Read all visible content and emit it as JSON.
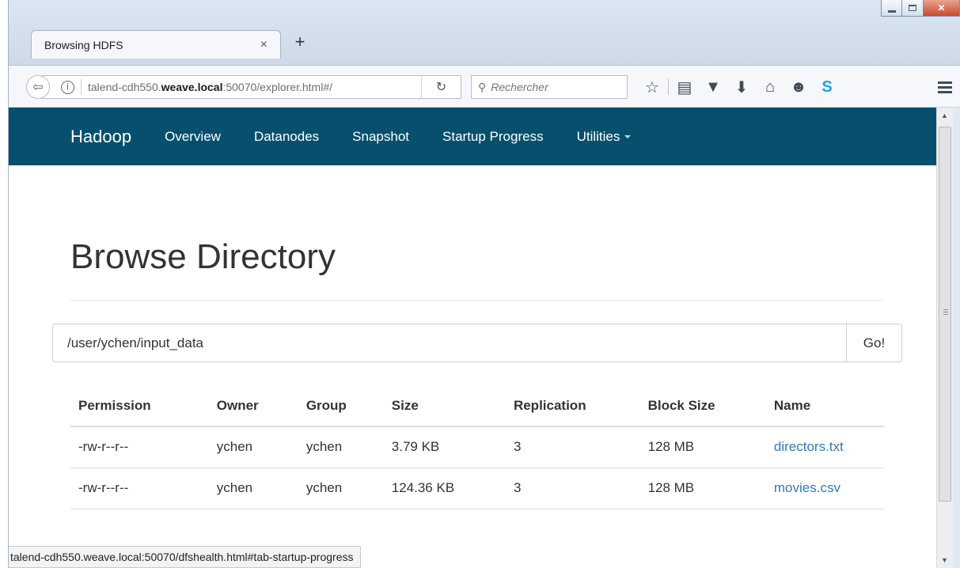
{
  "browser": {
    "tab_title": "Browsing HDFS",
    "tab_close": "×",
    "new_tab": "+",
    "url_prefix": "talend-cdh550.",
    "url_domain": "weave.local",
    "url_suffix": ":50070/explorer.html#/",
    "search_placeholder": "Rechercher",
    "status_url": "talend-cdh550.weave.local:50070/dfshealth.html#tab-startup-progress",
    "toolbar_icons": [
      "bookmark-star-icon",
      "reading-list-icon",
      "pocket-icon",
      "download-icon",
      "home-icon",
      "emoji-icon",
      "skype-icon",
      "menu-icon"
    ]
  },
  "nav": {
    "brand": "Hadoop",
    "items": [
      "Overview",
      "Datanodes",
      "Snapshot",
      "Startup Progress",
      "Utilities"
    ],
    "bg_color": "#06506e"
  },
  "page": {
    "title": "Browse Directory",
    "path_value": "/user/ychen/input_data",
    "go_label": "Go!"
  },
  "table": {
    "headers": [
      "Permission",
      "Owner",
      "Group",
      "Size",
      "Replication",
      "Block Size",
      "Name"
    ],
    "rows": [
      [
        "-rw-r--r--",
        "ychen",
        "ychen",
        "3.79 KB",
        "3",
        "128 MB",
        "directors.txt"
      ],
      [
        "-rw-r--r--",
        "ychen",
        "ychen",
        "124.36 KB",
        "3",
        "128 MB",
        "movies.csv"
      ]
    ],
    "link_color": "#337ab7"
  }
}
